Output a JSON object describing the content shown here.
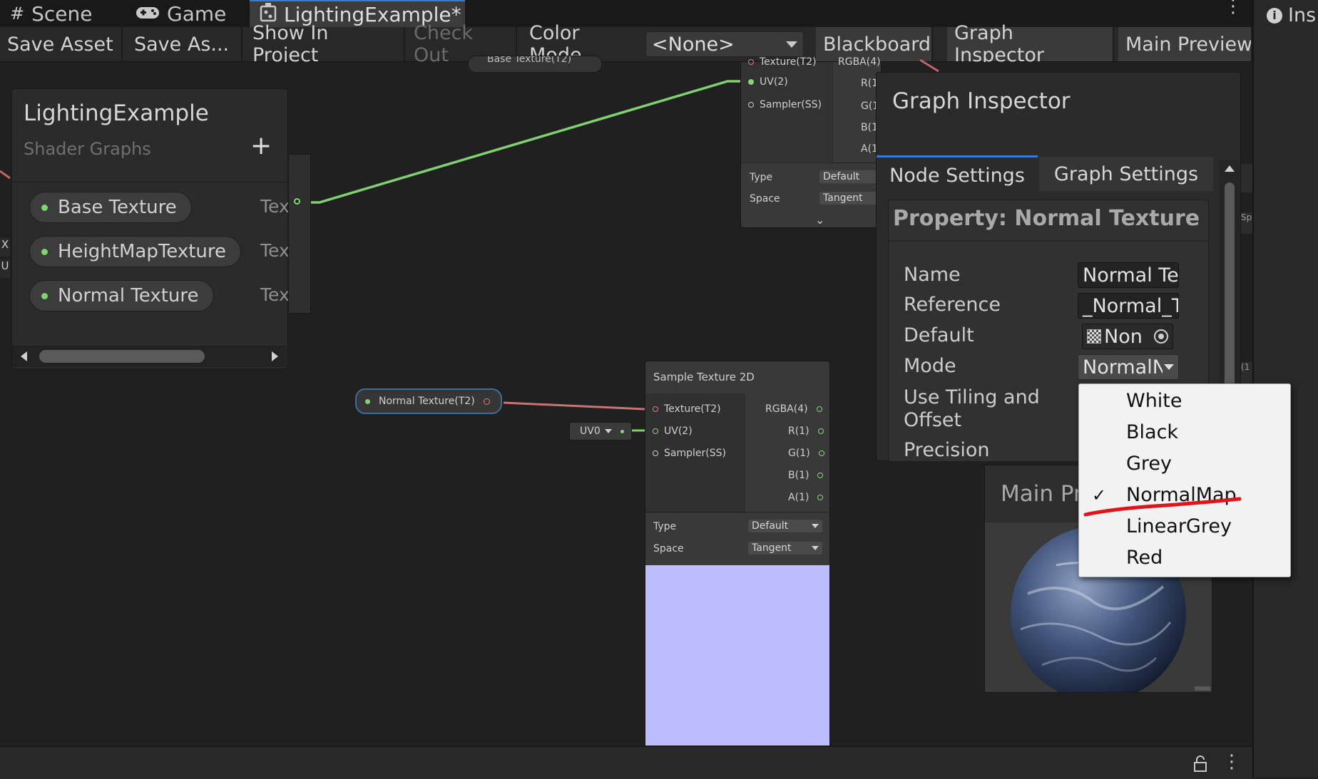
{
  "tabs": [
    {
      "label": "Scene",
      "icon": "grid-icon"
    },
    {
      "label": "Game",
      "icon": "gamepad-icon"
    },
    {
      "label": "LightingExample*",
      "icon": "shadergraph-icon"
    }
  ],
  "toolbar": {
    "save_asset": "Save Asset",
    "save_as": "Save As...",
    "show_in_project": "Show In Project",
    "check_out": "Check Out",
    "color_mode_label": "Color Mode",
    "color_mode_value": "<None>",
    "blackboard": "Blackboard",
    "graph_inspector": "Graph Inspector",
    "main_preview": "Main Preview"
  },
  "right_panel": {
    "label": "Ins"
  },
  "blackboard": {
    "title": "LightingExample",
    "subtitle": "Shader Graphs",
    "properties": [
      {
        "name": "Base Texture",
        "type": "Tex"
      },
      {
        "name": "HeightMapTexture",
        "type": "Tex"
      },
      {
        "name": "Normal Texture",
        "type": "Tex"
      }
    ]
  },
  "top_node": {
    "cut_label": "Base Texture(T2)",
    "inputs": [
      "Texture(T2)",
      "UV(2)",
      "Sampler(SS)"
    ],
    "outputs": [
      "RGBA(4)",
      "R(1",
      "G(1",
      "B(1",
      "A(1"
    ],
    "type_label": "Type",
    "type_value": "Default",
    "space_label": "Space",
    "space_value": "Tangent"
  },
  "property_node": {
    "label": "Normal Texture(T2)"
  },
  "uv_node": {
    "label": "UV0"
  },
  "sample_node": {
    "title": "Sample Texture 2D",
    "inputs": [
      "Texture(T2)",
      "UV(2)",
      "Sampler(SS)"
    ],
    "outputs": [
      "RGBA(4)",
      "R(1)",
      "G(1)",
      "B(1)",
      "A(1)"
    ],
    "type_label": "Type",
    "type_value": "Default",
    "space_label": "Space",
    "space_value": "Tangent",
    "preview_color": "#bcbcff"
  },
  "inspector": {
    "title": "Graph Inspector",
    "tab_node": "Node Settings",
    "tab_graph": "Graph Settings",
    "section": "Property: Normal Texture",
    "fields": {
      "name_label": "Name",
      "name_value": "Normal Te",
      "reference_label": "Reference",
      "reference_value": "_Normal_T",
      "default_label": "Default",
      "default_value": "Non",
      "mode_label": "Mode",
      "mode_value": "NormalN",
      "tiling_label_1": "Use Tiling and",
      "tiling_label_2": "Offset",
      "precision_label": "Precision"
    },
    "side_labels": [
      "Spa",
      "(1"
    ]
  },
  "preview": {
    "title": "Main Pr"
  },
  "mode_menu": {
    "options": [
      "White",
      "Black",
      "Grey",
      "NormalMap",
      "LinearGrey",
      "Red"
    ],
    "selected": "NormalMap",
    "annotation_color": "#e0141b"
  },
  "edge_labels": {
    "x": "X",
    "u": "U"
  }
}
